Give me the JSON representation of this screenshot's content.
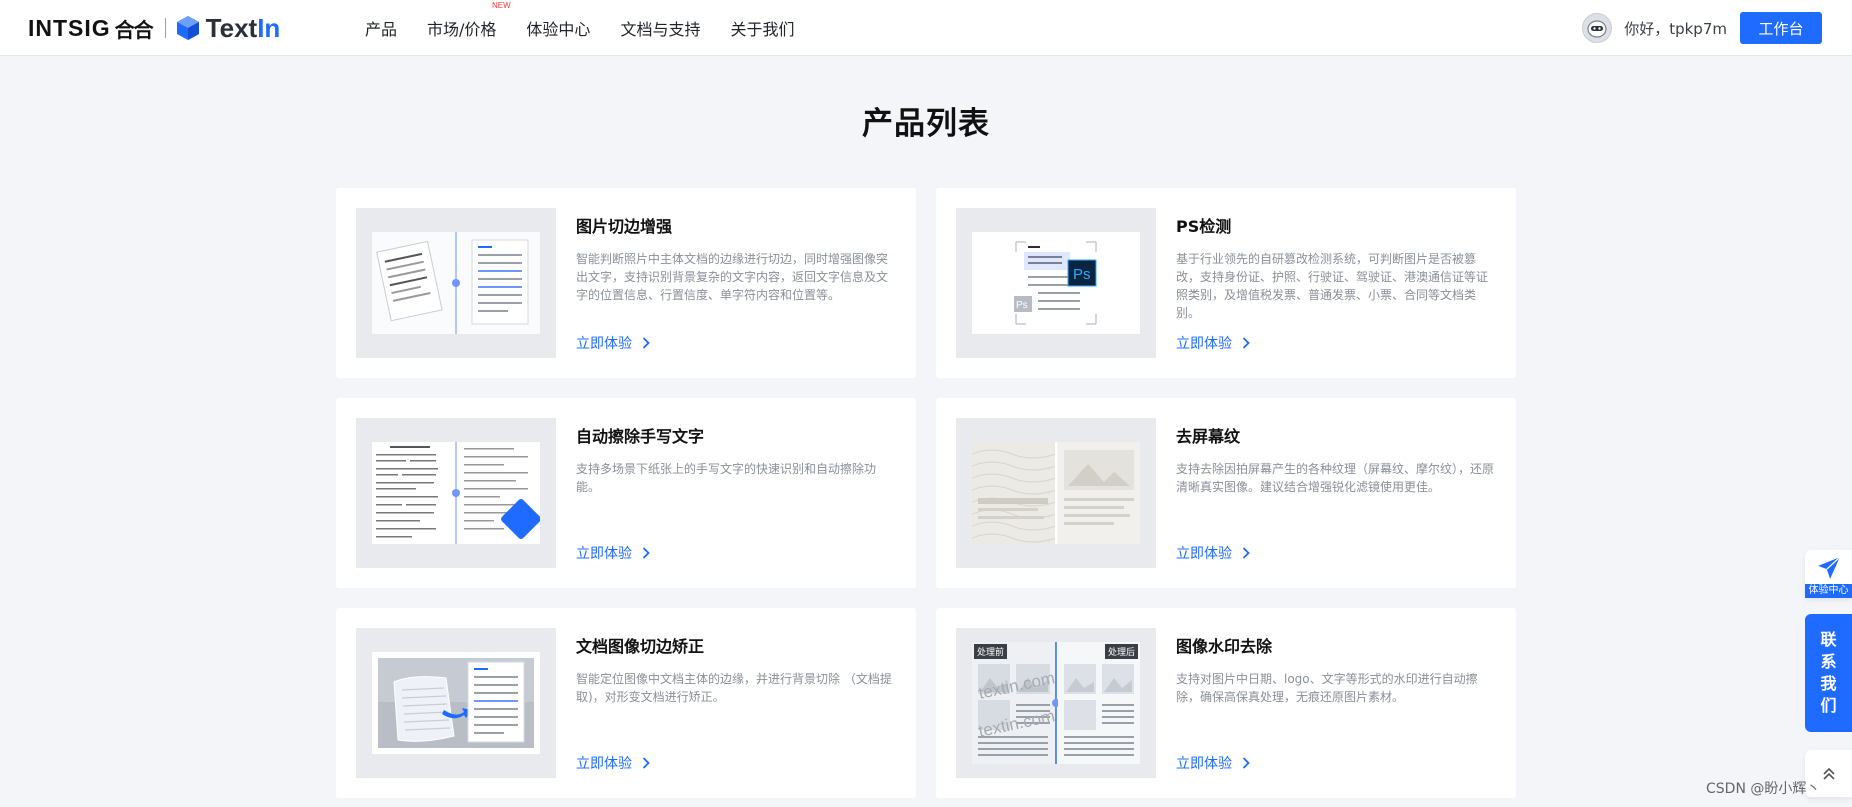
{
  "header": {
    "brand": {
      "intsig": "INTSIG",
      "hehe": "合合",
      "textin_text": "Text",
      "textin_in": "In"
    },
    "nav": [
      {
        "label": "产品"
      },
      {
        "label": "市场/价格",
        "badge": "NEW"
      },
      {
        "label": "体验中心"
      },
      {
        "label": "文档与支持"
      },
      {
        "label": "关于我们"
      }
    ],
    "user": {
      "greeting": "你好，tpkp7m",
      "workspace_label": "工作台"
    }
  },
  "main": {
    "title": "产品列表",
    "products": [
      {
        "title": "图片切边增强",
        "desc": "智能判断照片中主体文档的边缘进行切边，同时增强图像突出文字，支持识别背景复杂的文字内容，返回文字信息及文字的位置信息、行置信度、单字符内容和位置等。",
        "link": "立即体验",
        "icon": "crop-enhance-illustration"
      },
      {
        "title": "PS检测",
        "desc": "基于行业领先的自研篡改检测系统，可判断图片是否被篡改，支持身份证、护照、行驶证、驾驶证、港澳通信证等证照类别，及增值税发票、普通发票、小票、合同等文档类别。",
        "link": "立即体验",
        "icon": "ps-detect-illustration"
      },
      {
        "title": "自动擦除手写文字",
        "desc": "支持多场景下纸张上的手写文字的快速识别和自动擦除功能。",
        "link": "立即体验",
        "icon": "handwriting-erase-illustration"
      },
      {
        "title": "去屏幕纹",
        "desc": "支持去除因拍屏幕产生的各种纹理（屏幕纹、摩尔纹），还原清晰真实图像。建议结合增强锐化滤镜使用更佳。",
        "link": "立即体验",
        "icon": "moire-removal-illustration"
      },
      {
        "title": "文档图像切边矫正",
        "desc": "智能定位图像中文档主体的边缘，并进行背景切除 （文档提取)，对形变文档进行矫正。",
        "link": "立即体验",
        "icon": "dewarp-illustration"
      },
      {
        "title": "图像水印去除",
        "desc": "支持对图片中日期、logo、文字等形式的水印进行自动擦除，确保高保真处理，无痕还原图片素材。",
        "link": "立即体验",
        "icon": "watermark-removal-illustration",
        "before_label": "处理前",
        "after_label": "处理后",
        "watermark_text": "textin.com"
      }
    ]
  },
  "side": {
    "experience_label": "体验中心",
    "contact_chars": [
      "联",
      "系",
      "我",
      "们"
    ]
  },
  "footer": {
    "watermark": "CSDN @盼小辉丶"
  },
  "colors": {
    "accent": "#1f6bff",
    "background": "#f3f5f9",
    "new_badge": "#ff3b3b"
  }
}
